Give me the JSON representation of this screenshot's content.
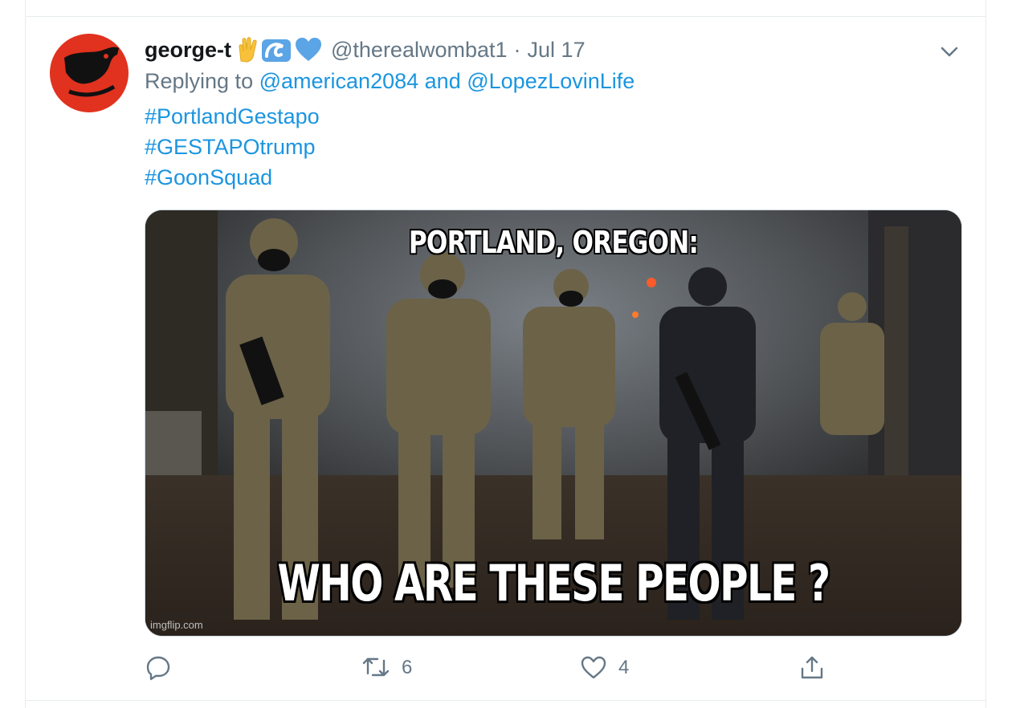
{
  "tweet": {
    "name": "george-t",
    "emoji": [
      "vulcan-salute-icon",
      "wave-icon",
      "blue-heart-icon"
    ],
    "handle": "@therealwombat1",
    "separator": "·",
    "date": "Jul 17",
    "replying_prefix": "Replying to",
    "mention_1": "@american2084",
    "and_text": "and",
    "mention_2": "@LopezLovinLife",
    "hashtags": [
      "#PortlandGestapo",
      "#GESTAPOtrump",
      "#GoonSquad"
    ],
    "media": {
      "top_caption": "PORTLAND, OREGON:",
      "bottom_caption": "WHO ARE THESE PEOPLE ?",
      "watermark": "imgflip.com"
    },
    "actions": {
      "reply_count": "",
      "retweet_count": "6",
      "like_count": "4"
    }
  },
  "colors": {
    "link": "#1b95e0",
    "secondary": "#657786",
    "primary": "#14171a",
    "avatar_bg": "#e0321f"
  }
}
